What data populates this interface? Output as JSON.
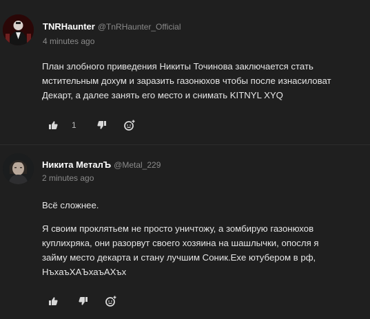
{
  "comments": [
    {
      "author": "TNRHaunter",
      "handle": "@TnRHaunter_Official",
      "time": "4 minutes ago",
      "paragraphs": [
        "План злобного приведения Никиты Точинова заключается стать",
        "мстительным дохум и заразить газонюхов чтобы после изнасиловат",
        "Декарт, а далее занять его место и снимать KITNYL XYQ"
      ],
      "likes": "1"
    },
    {
      "author": "Никита МеталЪ",
      "handle": "@Metal_229",
      "time": "2 minutes ago",
      "paragraphs": [
        "Всё сложнее.",
        "Я своим проклятьем не просто уничтожу, а зомбирую газонюхов",
        "куплихряка, они разорвут своего хозяина на шашлычки, опосля я",
        "займу место декарта и стану лучшим Соник.Exe ютубером в рф,",
        "НъхаъХАЪхаъАХъх"
      ],
      "likes": ""
    }
  ],
  "icons": {
    "like": "thumbs-up-icon",
    "dislike": "thumbs-down-icon",
    "reply": "reply-add-icon"
  },
  "colors": {
    "background": "#1f1f1f",
    "text": "#e6e6e6",
    "muted": "#8a8a8a"
  }
}
